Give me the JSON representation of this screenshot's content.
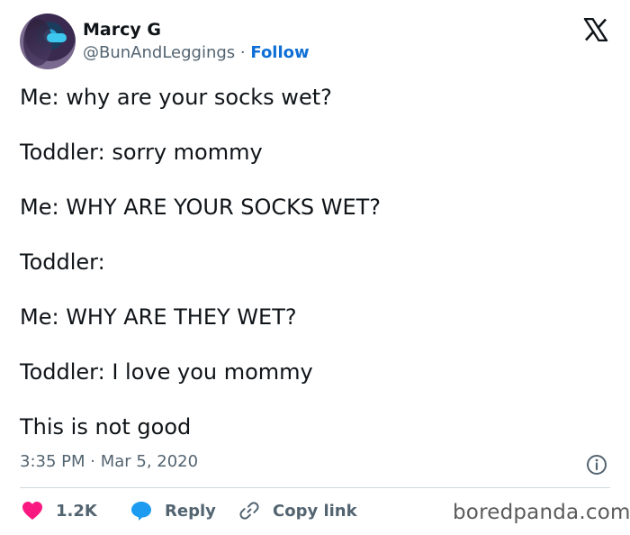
{
  "tweet": {
    "author_name": "Marcy G",
    "handle": "@BunAndLeggings",
    "separator": "·",
    "follow_label": "Follow",
    "lines": [
      "Me: why are your socks wet?",
      "Toddler: sorry mommy",
      "Me: WHY ARE YOUR SOCKS WET?",
      "Toddler:",
      "Me: WHY ARE THEY WET?",
      "Toddler: I love you mommy",
      "This is not good"
    ],
    "timestamp": "3:35 PM · Mar 5, 2020"
  },
  "actions": {
    "like_count": "1.2K",
    "reply_label": "Reply",
    "copy_label": "Copy link"
  },
  "watermark": "boredpanda.com",
  "colors": {
    "text": "#0f1419",
    "secondary": "#536471",
    "follow": "#0f6fd6",
    "like": "#f91880",
    "reply": "#1d9bf0",
    "divider": "#cfd9de"
  },
  "icons": [
    "x-logo-icon",
    "info-icon",
    "heart-icon",
    "reply-bubble-icon",
    "link-icon"
  ]
}
